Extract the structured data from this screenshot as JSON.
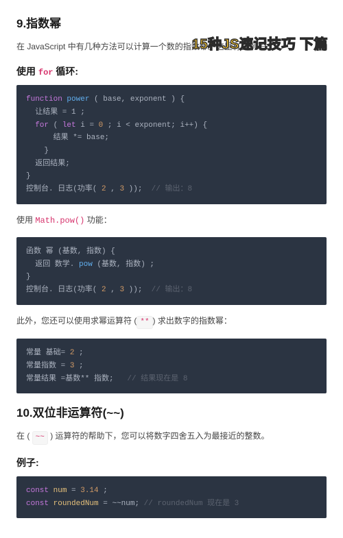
{
  "overlay": "15种JS速记技巧 下篇",
  "section9": {
    "heading": "9.指数幂",
    "intro": "在 JavaScript 中有几种方法可以计算一个数的指数幂。这里有些例子：",
    "h_for": "使用",
    "for_kw": "for",
    "h_for_tail": "循环:",
    "code1": {
      "l1_kw": "function",
      "l1_fn": "power",
      "l1_p": " ( base, exponent ) {",
      "l2": "  让结果 = 1 ;",
      "l3_kw": "for",
      "l3_p1": " ( ",
      "l3_let": "let",
      "l3_p2": " i = ",
      "l3_n0": "0",
      "l3_p3": " ; i < exponent; i++) {",
      "l4": "      结果 *= base;",
      "l5": "    }",
      "l6": "  返回结果;",
      "l7": "}",
      "l8a": "控制台. 日志(功率( ",
      "l8n1": "2",
      "l8m": " , ",
      "l8n2": "3",
      "l8b": " ));  ",
      "l8c": "// 输出：8"
    },
    "math_line_a": "使用 ",
    "math_fn": "Math.pow()",
    "math_line_b": " 功能：",
    "code2": {
      "l1": "函数 幂 (基数, 指数) {",
      "l2a": "  返回 数学. ",
      "l2fn": "pow",
      "l2b": " (基数, 指数) ;",
      "l3": "}",
      "l4a": "控制台. 日志(功率( ",
      "l4n1": "2",
      "l4m": " , ",
      "l4n2": "3",
      "l4b": " ));  ",
      "l4c": "// 输出：8"
    },
    "exp_line_a": "此外，您还可以使用求幂运算符 (",
    "exp_op": "**",
    "exp_line_b": ") 求出数字的指数幂：",
    "code3": {
      "l1a": "常量 基础= ",
      "l1n": "2",
      "l1b": " ;",
      "l2a": "常量指数 = ",
      "l2n": "3",
      "l2b": " ;",
      "l3a": "常量结果 =基数** 指数;   ",
      "l3c": "// 结果现在是 8"
    }
  },
  "section10": {
    "heading": "10.双位非运算符(~~)",
    "intro_a": "在 ( ",
    "op": "~~",
    "intro_b": " ) 运算符的帮助下，您可以将数字四舍五入为最接近的整数。",
    "h_ex": "例子:",
    "code": {
      "l1_kw": "const",
      "l1_id": " num",
      "l1_eq": " = ",
      "l1_n": "3.14",
      "l1_s": " ;",
      "l2_kw": "const",
      "l2_id": " roundedNum",
      "l2_eq": " = ~~num; ",
      "l2_c": "// roundedNum 现在是 3"
    }
  }
}
